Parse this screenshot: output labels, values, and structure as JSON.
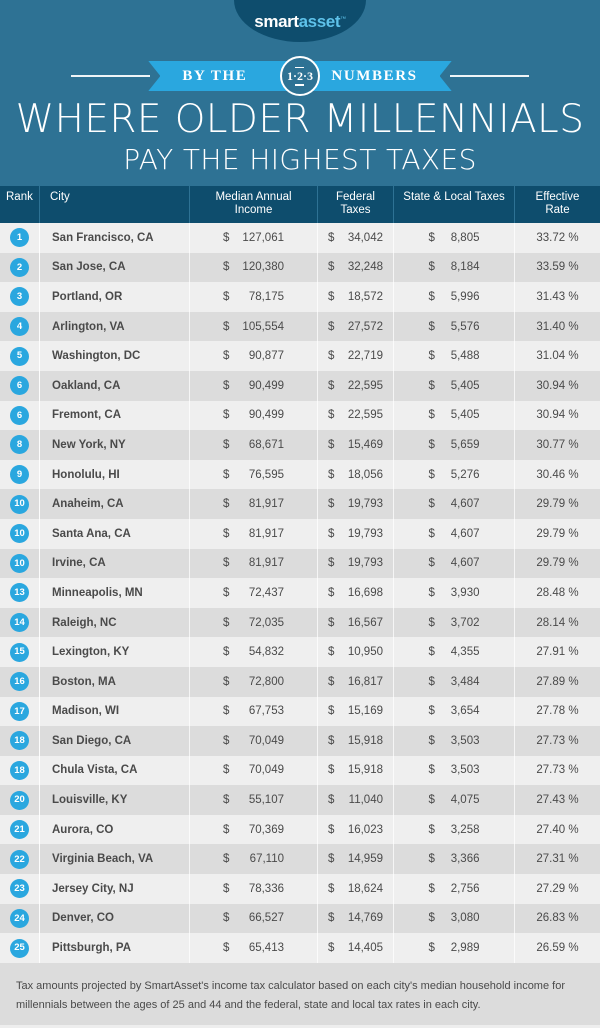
{
  "brand": {
    "logo_smart": "smart",
    "logo_asset": "asset",
    "logo_tm": "™"
  },
  "banner": {
    "label_left": "BY THE",
    "label_right": "NUMBERS",
    "seal_number": "1·2·3"
  },
  "title": {
    "main": "WHERE OLDER MILLENNIALS",
    "sub": "PAY THE HIGHEST TAXES"
  },
  "colors": {
    "header_bg": "#2e7294",
    "table_header_bg": "#0e4d6d",
    "accent_blue": "#2aa7df",
    "row_light": "#efefef",
    "row_dark": "#dcdcdc",
    "text": "#4a4a4a"
  },
  "table": {
    "columns": [
      {
        "key": "rank",
        "label": "Rank"
      },
      {
        "key": "city",
        "label": "City"
      },
      {
        "key": "income",
        "label": "Median Annual Income"
      },
      {
        "key": "federal",
        "label": "Federal Taxes"
      },
      {
        "key": "state_local",
        "label": "State & Local Taxes"
      },
      {
        "key": "rate",
        "label": "Effective Rate"
      }
    ],
    "rows": [
      {
        "rank": "1",
        "city": "San Francisco, CA",
        "income_sym": "$",
        "income": "127,061",
        "federal_sym": "$",
        "federal": "34,042",
        "state_sym": "$",
        "state_local": "8,805",
        "rate": "33.72 %"
      },
      {
        "rank": "2",
        "city": "San Jose, CA",
        "income_sym": "$",
        "income": "120,380",
        "federal_sym": "$",
        "federal": "32,248",
        "state_sym": "$",
        "state_local": "8,184",
        "rate": "33.59 %"
      },
      {
        "rank": "3",
        "city": "Portland, OR",
        "income_sym": "$",
        "income": "78,175",
        "federal_sym": "$",
        "federal": "18,572",
        "state_sym": "$",
        "state_local": "5,996",
        "rate": "31.43 %"
      },
      {
        "rank": "4",
        "city": "Arlington, VA",
        "income_sym": "$",
        "income": "105,554",
        "federal_sym": "$",
        "federal": "27,572",
        "state_sym": "$",
        "state_local": "5,576",
        "rate": "31.40 %"
      },
      {
        "rank": "5",
        "city": "Washington, DC",
        "income_sym": "$",
        "income": "90,877",
        "federal_sym": "$",
        "federal": "22,719",
        "state_sym": "$",
        "state_local": "5,488",
        "rate": "31.04 %"
      },
      {
        "rank": "6",
        "city": "Oakland, CA",
        "income_sym": "$",
        "income": "90,499",
        "federal_sym": "$",
        "federal": "22,595",
        "state_sym": "$",
        "state_local": "5,405",
        "rate": "30.94 %"
      },
      {
        "rank": "6",
        "city": "Fremont, CA",
        "income_sym": "$",
        "income": "90,499",
        "federal_sym": "$",
        "federal": "22,595",
        "state_sym": "$",
        "state_local": "5,405",
        "rate": "30.94 %"
      },
      {
        "rank": "8",
        "city": "New York, NY",
        "income_sym": "$",
        "income": "68,671",
        "federal_sym": "$",
        "federal": "15,469",
        "state_sym": "$",
        "state_local": "5,659",
        "rate": "30.77 %"
      },
      {
        "rank": "9",
        "city": "Honolulu, HI",
        "income_sym": "$",
        "income": "76,595",
        "federal_sym": "$",
        "federal": "18,056",
        "state_sym": "$",
        "state_local": "5,276",
        "rate": "30.46 %"
      },
      {
        "rank": "10",
        "city": "Anaheim, CA",
        "income_sym": "$",
        "income": "81,917",
        "federal_sym": "$",
        "federal": "19,793",
        "state_sym": "$",
        "state_local": "4,607",
        "rate": "29.79 %"
      },
      {
        "rank": "10",
        "city": "Santa Ana, CA",
        "income_sym": "$",
        "income": "81,917",
        "federal_sym": "$",
        "federal": "19,793",
        "state_sym": "$",
        "state_local": "4,607",
        "rate": "29.79 %"
      },
      {
        "rank": "10",
        "city": "Irvine, CA",
        "income_sym": "$",
        "income": "81,917",
        "federal_sym": "$",
        "federal": "19,793",
        "state_sym": "$",
        "state_local": "4,607",
        "rate": "29.79 %"
      },
      {
        "rank": "13",
        "city": "Minneapolis, MN",
        "income_sym": "$",
        "income": "72,437",
        "federal_sym": "$",
        "federal": "16,698",
        "state_sym": "$",
        "state_local": "3,930",
        "rate": "28.48 %"
      },
      {
        "rank": "14",
        "city": "Raleigh, NC",
        "income_sym": "$",
        "income": "72,035",
        "federal_sym": "$",
        "federal": "16,567",
        "state_sym": "$",
        "state_local": "3,702",
        "rate": "28.14 %"
      },
      {
        "rank": "15",
        "city": "Lexington, KY",
        "income_sym": "$",
        "income": "54,832",
        "federal_sym": "$",
        "federal": "10,950",
        "state_sym": "$",
        "state_local": "4,355",
        "rate": "27.91 %"
      },
      {
        "rank": "16",
        "city": "Boston, MA",
        "income_sym": "$",
        "income": "72,800",
        "federal_sym": "$",
        "federal": "16,817",
        "state_sym": "$",
        "state_local": "3,484",
        "rate": "27.89 %"
      },
      {
        "rank": "17",
        "city": "Madison, WI",
        "income_sym": "$",
        "income": "67,753",
        "federal_sym": "$",
        "federal": "15,169",
        "state_sym": "$",
        "state_local": "3,654",
        "rate": "27.78 %"
      },
      {
        "rank": "18",
        "city": "San Diego, CA",
        "income_sym": "$",
        "income": "70,049",
        "federal_sym": "$",
        "federal": "15,918",
        "state_sym": "$",
        "state_local": "3,503",
        "rate": "27.73 %"
      },
      {
        "rank": "18",
        "city": "Chula Vista, CA",
        "income_sym": "$",
        "income": "70,049",
        "federal_sym": "$",
        "federal": "15,918",
        "state_sym": "$",
        "state_local": "3,503",
        "rate": "27.73 %"
      },
      {
        "rank": "20",
        "city": "Louisville, KY",
        "income_sym": "$",
        "income": "55,107",
        "federal_sym": "$",
        "federal": "11,040",
        "state_sym": "$",
        "state_local": "4,075",
        "rate": "27.43 %"
      },
      {
        "rank": "21",
        "city": "Aurora, CO",
        "income_sym": "$",
        "income": "70,369",
        "federal_sym": "$",
        "federal": "16,023",
        "state_sym": "$",
        "state_local": "3,258",
        "rate": "27.40 %"
      },
      {
        "rank": "22",
        "city": "Virginia Beach, VA",
        "income_sym": "$",
        "income": "67,110",
        "federal_sym": "$",
        "federal": "14,959",
        "state_sym": "$",
        "state_local": "3,366",
        "rate": "27.31 %"
      },
      {
        "rank": "23",
        "city": "Jersey City, NJ",
        "income_sym": "$",
        "income": "78,336",
        "federal_sym": "$",
        "federal": "18,624",
        "state_sym": "$",
        "state_local": "2,756",
        "rate": "27.29 %"
      },
      {
        "rank": "24",
        "city": "Denver, CO",
        "income_sym": "$",
        "income": "66,527",
        "federal_sym": "$",
        "federal": "14,769",
        "state_sym": "$",
        "state_local": "3,080",
        "rate": "26.83 %"
      },
      {
        "rank": "25",
        "city": "Pittsburgh, PA",
        "income_sym": "$",
        "income": "65,413",
        "federal_sym": "$",
        "federal": "14,405",
        "state_sym": "$",
        "state_local": "2,989",
        "rate": "26.59 %"
      }
    ]
  },
  "footnote": "Tax amounts projected by SmartAsset's income tax calculator based on each city's median household income for millennials between the ages of 25 and 44 and the federal, state and local tax rates in each city."
}
